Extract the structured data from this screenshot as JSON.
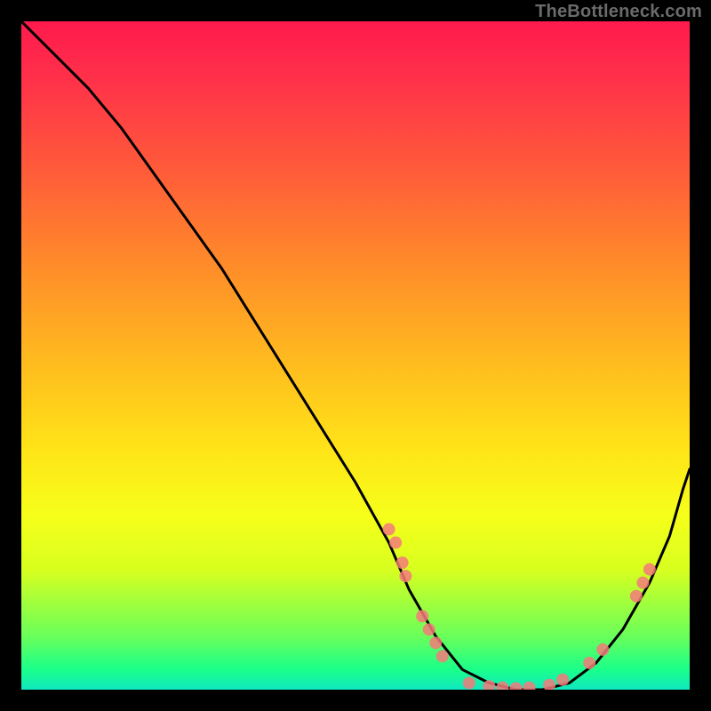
{
  "watermark": "TheBottleneck.com",
  "chart_data": {
    "type": "line",
    "title": "",
    "xlabel": "",
    "ylabel": "",
    "xlim": [
      0,
      100
    ],
    "ylim": [
      0,
      100
    ],
    "grid": false,
    "legend": false,
    "curve": {
      "name": "bottleneck-curve",
      "x": [
        0,
        5,
        10,
        15,
        20,
        25,
        30,
        35,
        40,
        45,
        50,
        55,
        58,
        62,
        66,
        70,
        74,
        78,
        82,
        86,
        90,
        94,
        97,
        99,
        100
      ],
      "y": [
        100,
        95,
        90,
        84,
        77,
        70,
        63,
        55,
        47,
        39,
        31,
        22,
        15,
        8,
        3,
        1,
        0,
        0,
        1,
        4,
        9,
        16,
        23,
        30,
        33
      ]
    },
    "marker_clusters": [
      {
        "name": "left-upper",
        "color": "#f47a7a",
        "points": [
          {
            "x": 55,
            "y": 24
          },
          {
            "x": 56,
            "y": 22
          },
          {
            "x": 57,
            "y": 19
          },
          {
            "x": 57.5,
            "y": 17
          }
        ]
      },
      {
        "name": "left-lower",
        "color": "#f47a7a",
        "points": [
          {
            "x": 60,
            "y": 11
          },
          {
            "x": 61,
            "y": 9
          },
          {
            "x": 62,
            "y": 7
          },
          {
            "x": 63,
            "y": 5
          }
        ]
      },
      {
        "name": "valley",
        "color": "#f47a7a",
        "points": [
          {
            "x": 67,
            "y": 1
          },
          {
            "x": 70,
            "y": 0.5
          },
          {
            "x": 72,
            "y": 0.3
          },
          {
            "x": 74,
            "y": 0.2
          },
          {
            "x": 76,
            "y": 0.3
          },
          {
            "x": 79,
            "y": 0.7
          },
          {
            "x": 81,
            "y": 1.5
          }
        ]
      },
      {
        "name": "right-lower",
        "color": "#f47a7a",
        "points": [
          {
            "x": 85,
            "y": 4
          },
          {
            "x": 87,
            "y": 6
          }
        ]
      },
      {
        "name": "right-upper",
        "color": "#f47a7a",
        "points": [
          {
            "x": 92,
            "y": 14
          },
          {
            "x": 93,
            "y": 16
          },
          {
            "x": 94,
            "y": 18
          }
        ]
      }
    ],
    "note": "No axes, ticks, or labels visible. Background is a vertical red→yellow→green gradient. A black V-shaped curve with salmon-colored circular markers clustered along segments of the curve near and around the valley."
  }
}
